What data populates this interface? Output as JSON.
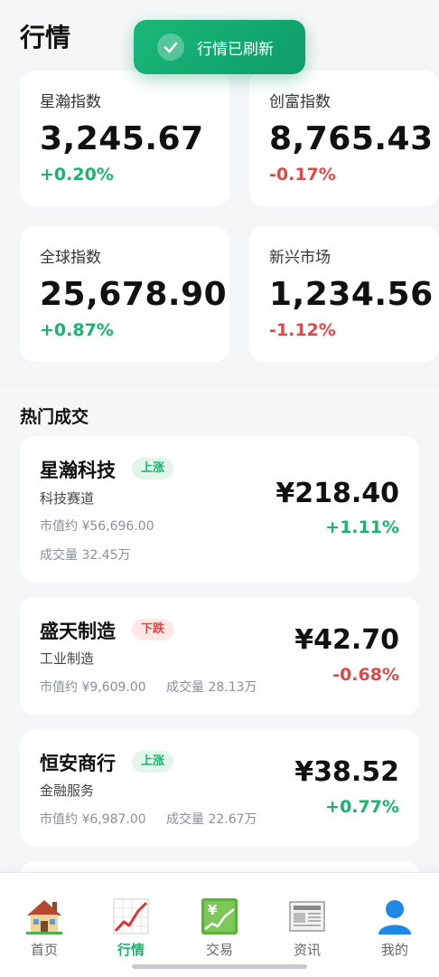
{
  "header": {
    "title": "行情"
  },
  "toast": {
    "text": "行情已刷新"
  },
  "indices": [
    {
      "name": "星瀚指数",
      "value": "3,245.67",
      "change": "+0.20%",
      "direction": "up"
    },
    {
      "name": "创富指数",
      "value": "8,765.43",
      "change": "-0.17%",
      "direction": "down"
    },
    {
      "name": "全球指数",
      "value": "25,678.90",
      "change": "+0.87%",
      "direction": "up"
    },
    {
      "name": "新兴市场",
      "value": "1,234.56",
      "change": "-1.12%",
      "direction": "down"
    }
  ],
  "hot": {
    "title": "热门成交",
    "stocks": [
      {
        "name": "星瀚科技",
        "tag": "上涨",
        "sector": "科技赛道",
        "market_cap": "市值约 ¥56,696.00",
        "volume": "成交量 32.45万",
        "price": "¥218.40",
        "change": "+1.11%",
        "direction": "up"
      },
      {
        "name": "盛天制造",
        "tag": "下跌",
        "sector": "工业制造",
        "market_cap": "市值约 ¥9,609.00",
        "volume": "成交量 28.13万",
        "price": "¥42.70",
        "change": "-0.68%",
        "direction": "down"
      },
      {
        "name": "恒安商行",
        "tag": "上涨",
        "sector": "金融服务",
        "market_cap": "市值约 ¥6,987.00",
        "volume": "成交量 22.67万",
        "price": "¥38.52",
        "change": "+0.77%",
        "direction": "up"
      }
    ]
  },
  "tabbar": {
    "tabs": [
      {
        "label": "首页",
        "icon": "house-icon"
      },
      {
        "label": "行情",
        "icon": "chart-trend-icon",
        "active": true
      },
      {
        "label": "交易",
        "icon": "yen-chart-icon"
      },
      {
        "label": "资讯",
        "icon": "newspaper-icon"
      },
      {
        "label": "我的",
        "icon": "user-icon"
      }
    ]
  },
  "colors": {
    "up": "#19b46e",
    "down": "#e04848",
    "accent": "#19b46e"
  }
}
